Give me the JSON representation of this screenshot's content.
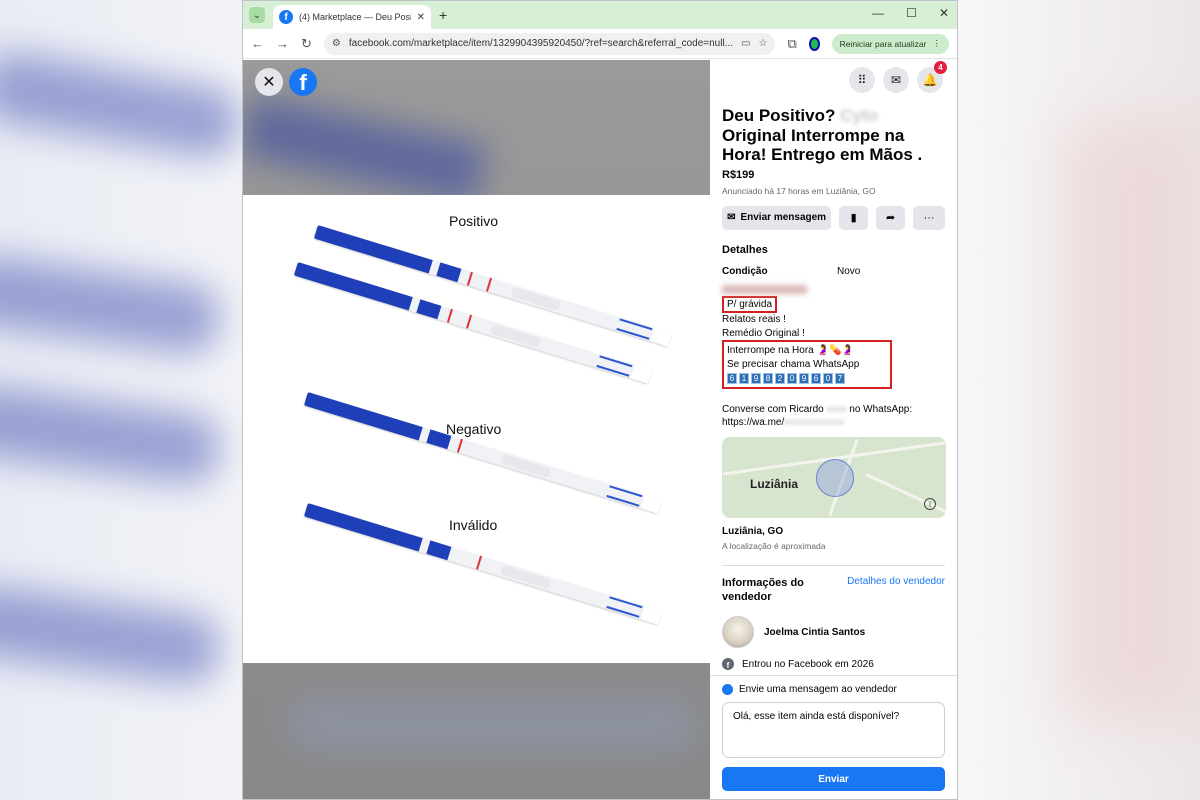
{
  "browser": {
    "tab_title": "(4) Marketplace — Deu Positivo",
    "url": "facebook.com/marketplace/item/1329904395920450/?ref=search&referral_code=null...",
    "update_button": "Reiniciar para atualizar"
  },
  "photo": {
    "labels": [
      "Positivo",
      "Negativo",
      "Inválido"
    ]
  },
  "header": {
    "notification_count": "4"
  },
  "listing": {
    "title_part1": "Deu Positivo?",
    "title_hidden": "Cyto",
    "title_part2": "Original Interrompe na Hora! Entrego em Mãos .",
    "price": "R$199",
    "listed": "Anunciado há 17 horas em Luziânia, GO",
    "send_message": "Enviar mensagem"
  },
  "details": {
    "heading": "Detalhes",
    "condition_label": "Condição",
    "condition_value": "Novo",
    "desc_line1": "P/ grávida",
    "desc_line2": "Relatos reais !",
    "desc_line3": "Remédio Original !",
    "desc_line4": "Interrompe na Hora 🤰💊🤰",
    "desc_line5": "Se precisar chama  WhatsApp",
    "digits": [
      "6",
      "1",
      "9",
      "8",
      "2",
      "0",
      "9",
      "6",
      "0",
      "7"
    ],
    "convo_line1": "Converse com Ricardo",
    "convo_hidden": "xxxx",
    "convo_line1b": "no WhatsApp:",
    "convo_line2": "https://wa.me/",
    "convo_hidden2": "xxxxxxxxxxxx"
  },
  "map": {
    "city": "Luziânia",
    "location": "Luziânia, GO",
    "approx": "A localização é aproximada"
  },
  "seller": {
    "heading": "Informações do vendedor",
    "details_link": "Detalhes do vendedor",
    "name": "Joelma Cintia Santos",
    "joined": "Entrou no Facebook em 2026"
  },
  "message": {
    "heading": "Envie uma mensagem ao vendedor",
    "text": "Olá, esse item ainda está disponível?",
    "send": "Enviar"
  }
}
